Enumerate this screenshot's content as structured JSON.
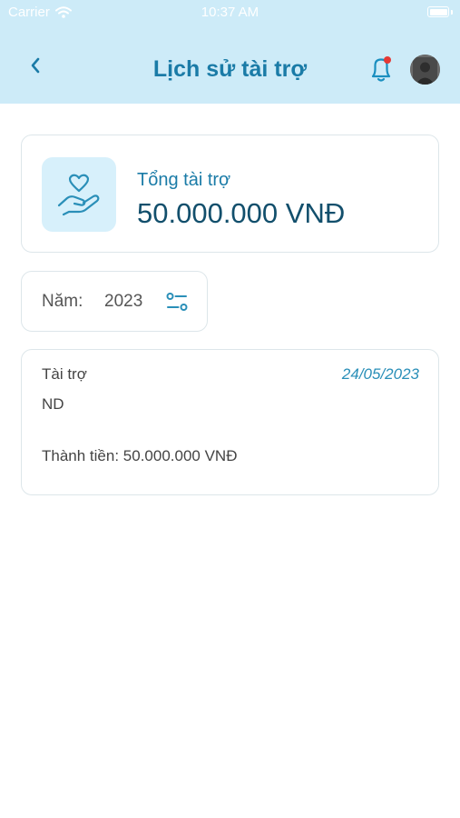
{
  "status_bar": {
    "carrier": "Carrier",
    "time": "10:37 AM"
  },
  "header": {
    "title": "Lịch sử tài trợ",
    "back_icon": "chevron-left-icon",
    "notification_icon": "bell-icon",
    "notification_badge_color": "#e53935"
  },
  "summary": {
    "label": "Tổng tài trợ",
    "value": "50.000.000 VNĐ",
    "icon": "heart-hand-icon"
  },
  "filter": {
    "label": "Năm:",
    "value": "2023",
    "icon": "filter-icon"
  },
  "records": [
    {
      "type": "Tài trợ",
      "date": "24/05/2023",
      "donor": "ND",
      "amount": "Thành tiền: 50.000.000 VNĐ"
    }
  ],
  "colors": {
    "header_bg": "#cdebf8",
    "accent": "#1a7ba7",
    "value_text": "#124f6c",
    "date_text": "#2a8fb8"
  }
}
